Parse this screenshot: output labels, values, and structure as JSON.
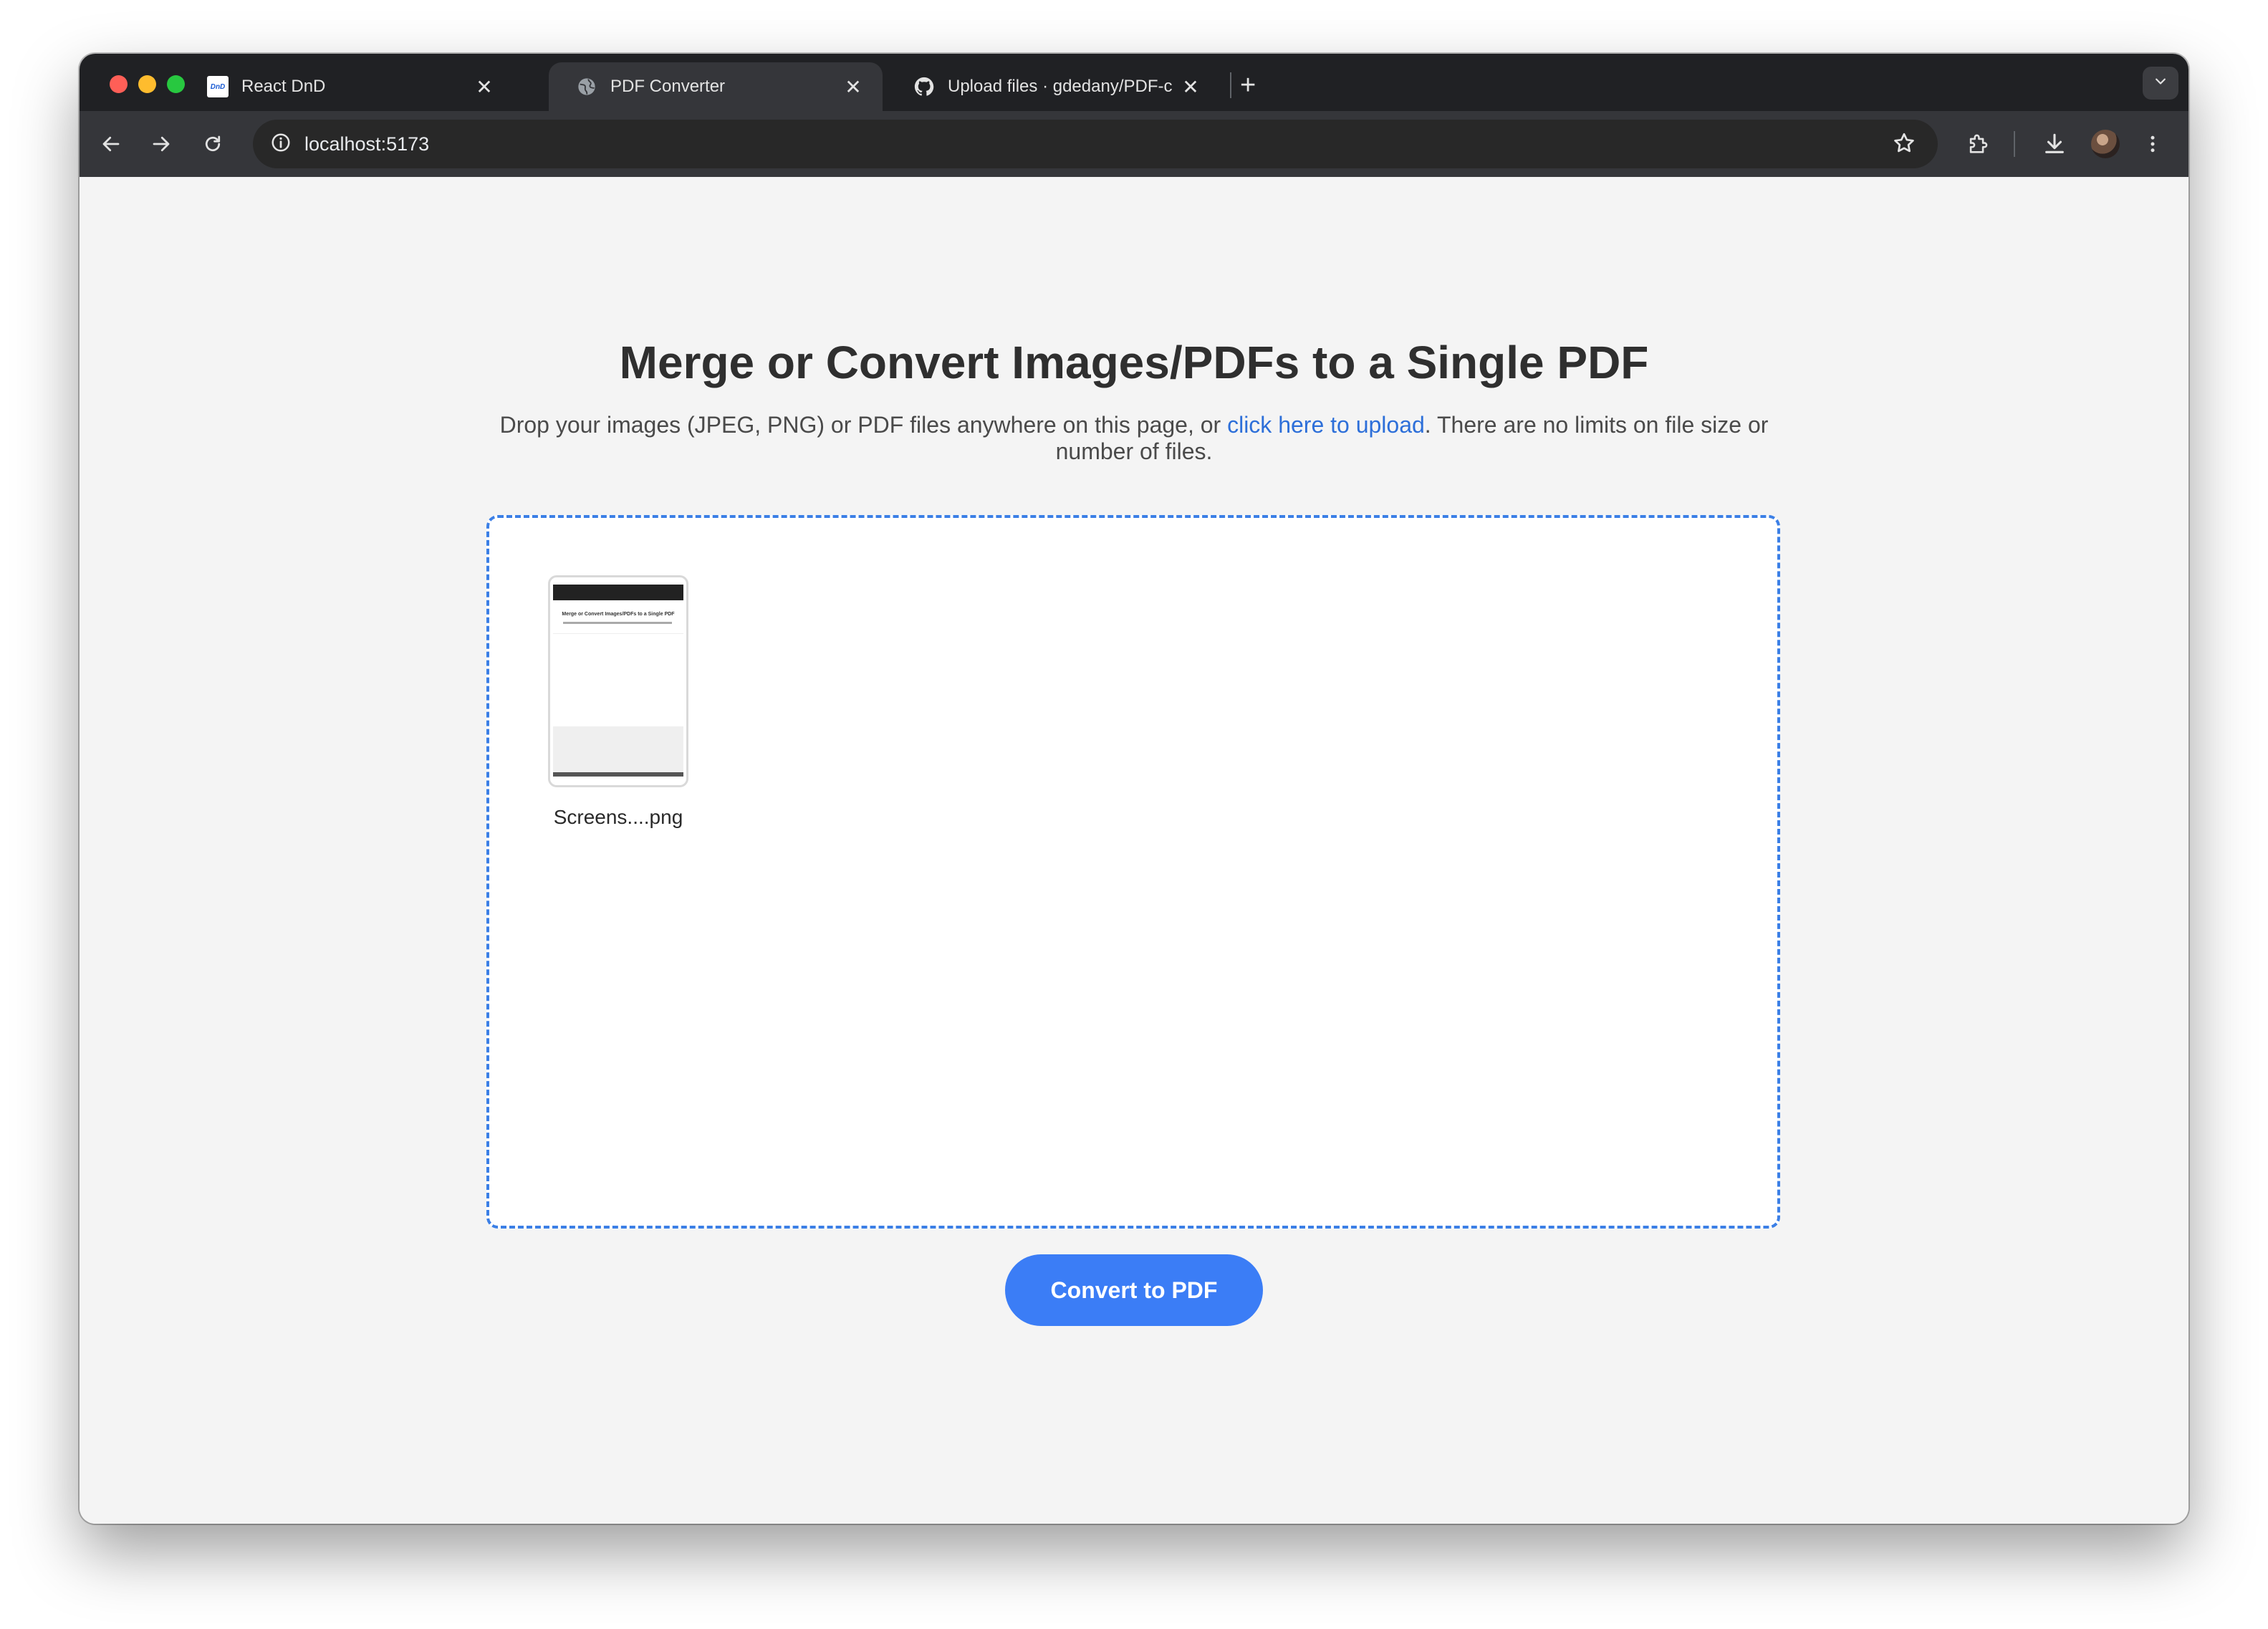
{
  "browser": {
    "tabs": [
      {
        "title": "React DnD",
        "favicon": "dnd-logo-icon",
        "favicon_text": "DnD",
        "active": false
      },
      {
        "title": "PDF Converter",
        "favicon": "globe-icon",
        "active": true
      },
      {
        "title": "Upload files · gdedany/PDF-c",
        "favicon": "github-icon",
        "active": false
      }
    ],
    "new_tab": "+",
    "address": "localhost:5173"
  },
  "page": {
    "heading": "Merge or Convert Images/PDFs to a Single PDF",
    "description_before": "Drop your images (JPEG, PNG) or PDF files anywhere on this page, or ",
    "upload_link": "click here to upload",
    "description_after": ". There are no limits on file size or number of files.",
    "files": [
      {
        "name": "Screens....png",
        "thumbnail_title": "Merge or Convert Images/PDFs to a Single PDF"
      }
    ],
    "convert_button": "Convert to PDF"
  },
  "colors": {
    "accent": "#3b7df6",
    "link": "#2d6fd9",
    "dropzone_border": "#3b7fe6",
    "page_background": "#f4f4f4",
    "chrome_dark": "#202124"
  }
}
